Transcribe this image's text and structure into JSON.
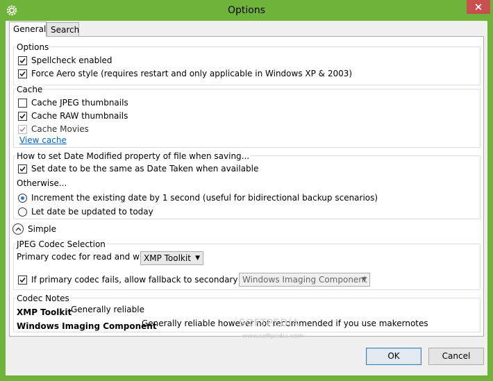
{
  "window": {
    "title": "Options",
    "accent_color": "#70b33a",
    "close_color": "#c7504f"
  },
  "tabs": [
    {
      "label": "General",
      "active": true
    },
    {
      "label": "Search",
      "active": false
    }
  ],
  "options": {
    "title": "Options",
    "spellcheck": {
      "label": "Spellcheck enabled",
      "checked": true
    },
    "aero": {
      "label": "Force Aero style (requires restart and only applicable in Windows XP & 2003)",
      "checked": true
    }
  },
  "cache": {
    "title": "Cache",
    "jpeg": {
      "label": "Cache JPEG thumbnails",
      "checked": false
    },
    "raw": {
      "label": "Cache RAW thumbnails",
      "checked": true
    },
    "movies": {
      "label": "Cache Movies",
      "checked": true,
      "disabled": true
    },
    "view_link": "View cache"
  },
  "date_modified": {
    "title": "How to set Date Modified property of file when saving...",
    "same_as_taken": {
      "label": "Set date to be the same as Date Taken when available",
      "checked": true
    },
    "otherwise": "Otherwise...",
    "increment": {
      "label": "Increment the existing date by 1 second (useful for bidirectional backup scenarios)",
      "selected": true
    },
    "today": {
      "label": "Let date be updated to today",
      "selected": false
    }
  },
  "expander": {
    "label": "Simple",
    "icon": "chevron-up-icon"
  },
  "jpeg_codec": {
    "title": "JPEG Codec Selection",
    "primary_label": "Primary codec for read and write",
    "primary_value": "XMP Toolkit",
    "fallback": {
      "label": "If primary codec fails, allow fallback to secondary codec",
      "checked": true
    },
    "secondary_value": "Windows Imaging Component"
  },
  "codec_notes": {
    "title": "Codec Notes",
    "items": [
      {
        "name": "XMP Toolkit",
        "note": "Generally reliable"
      },
      {
        "name": "Windows Imaging Component",
        "note": "Generally reliable however not recommended if you use makernotes"
      }
    ]
  },
  "watermark": {
    "text": "SOFTPEDIA",
    "sub": "www.softpedia.com"
  },
  "buttons": {
    "ok": "OK",
    "cancel": "Cancel"
  }
}
